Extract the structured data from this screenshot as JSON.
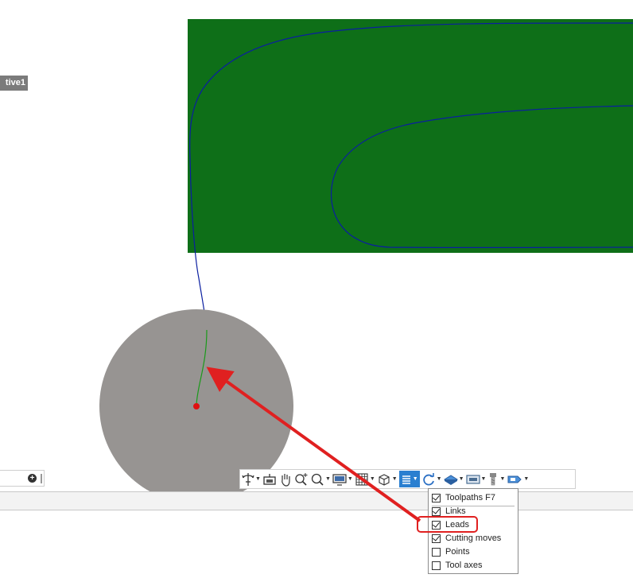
{
  "operation_label": "tive1",
  "colors": {
    "stock_green": "#0e6f18",
    "toolpath_blue": "#0a1ea0",
    "lead_green": "#1a9a1a",
    "tool_gray": "#979492",
    "start_point": "#e01010",
    "annotation_red": "#e02020",
    "active_button": "#2a7fd0"
  },
  "toolbar": {
    "buttons": [
      {
        "name": "orbit-icon",
        "has_dropdown": true
      },
      {
        "name": "look-at-icon",
        "has_dropdown": false
      },
      {
        "name": "pan-hand-icon",
        "has_dropdown": false
      },
      {
        "name": "zoom-icon",
        "has_dropdown": false
      },
      {
        "name": "fit-zoom-icon",
        "has_dropdown": true
      },
      {
        "name": "display-settings-icon",
        "has_dropdown": true
      },
      {
        "name": "grid-icon",
        "has_dropdown": true
      },
      {
        "name": "view-cube-icon",
        "has_dropdown": true
      },
      {
        "name": "toolpath-display-icon",
        "has_dropdown": true,
        "active": true
      },
      {
        "name": "refresh-icon",
        "has_dropdown": true
      },
      {
        "name": "stock-icon",
        "has_dropdown": true
      },
      {
        "name": "screen-icon",
        "has_dropdown": true
      },
      {
        "name": "tool-icon",
        "has_dropdown": true
      },
      {
        "name": "machine-icon",
        "has_dropdown": true
      }
    ]
  },
  "menu": {
    "items": [
      {
        "label": "Toolpaths F7",
        "checked": true
      },
      {
        "label": "Links",
        "checked": true
      },
      {
        "label": "Leads",
        "checked": true,
        "highlighted": true
      },
      {
        "label": "Cutting moves",
        "checked": true
      },
      {
        "label": "Points",
        "checked": false
      },
      {
        "label": "Tool axes",
        "checked": false
      }
    ]
  }
}
